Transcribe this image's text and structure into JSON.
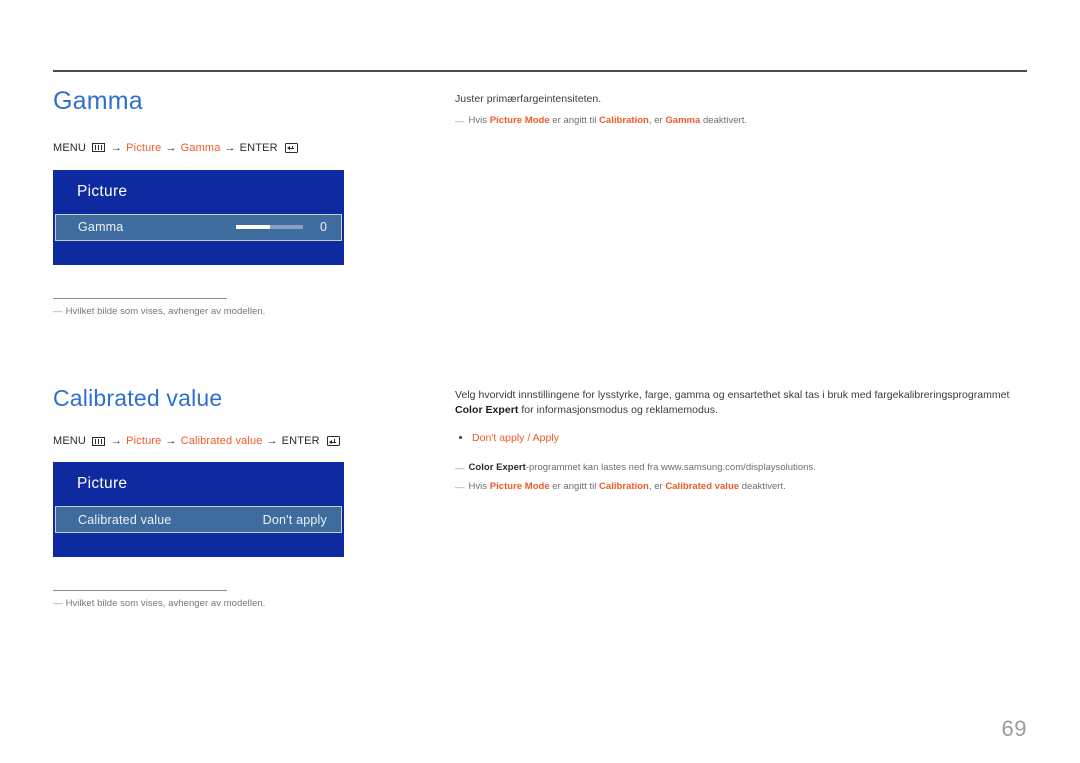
{
  "page": {
    "number": "69"
  },
  "sections": [
    {
      "title": "Gamma",
      "breadcrumb": {
        "menu_label": "MENU",
        "menu_icon": "menu-bars-icon",
        "arrow": "→",
        "parts": [
          "Picture",
          "Gamma"
        ],
        "enter_label": "ENTER",
        "enter_icon": "enter-return-icon"
      },
      "osd": {
        "header": "Picture",
        "row_label": "Gamma",
        "row_value": "0",
        "slider_fill_percent": 50
      },
      "footnote": {
        "dash": "―",
        "text": "Hvilket bilde som vises, avhenger av modellen."
      },
      "description": "Juster primærfargeintensiteten.",
      "notes": [
        {
          "dash": "―",
          "segments": [
            {
              "text": "Hvis ",
              "style": "plain"
            },
            {
              "text": "Picture Mode",
              "style": "accent"
            },
            {
              "text": " er angitt til ",
              "style": "plain"
            },
            {
              "text": "Calibration",
              "style": "accent"
            },
            {
              "text": ", er ",
              "style": "plain"
            },
            {
              "text": "Gamma",
              "style": "accent"
            },
            {
              "text": " deaktivert.",
              "style": "plain"
            }
          ]
        }
      ]
    },
    {
      "title": "Calibrated value",
      "breadcrumb": {
        "menu_label": "MENU",
        "menu_icon": "menu-bars-icon",
        "arrow": "→",
        "parts": [
          "Picture",
          "Calibrated value"
        ],
        "enter_label": "ENTER",
        "enter_icon": "enter-return-icon"
      },
      "osd": {
        "header": "Picture",
        "row_label": "Calibrated value",
        "row_value": "Don't apply"
      },
      "footnote": {
        "dash": "―",
        "text": "Hvilket bilde som vises, avhenger av modellen."
      },
      "description_segments": [
        {
          "text": "Velg hvorvidt innstillingene for lysstyrke, farge, gamma og ensartethet skal tas i bruk med fargekalibreringsprogrammet ",
          "style": "plain"
        },
        {
          "text": "Color Expert",
          "style": "bold"
        },
        {
          "text": " for informasjonsmodus og reklamemodus.",
          "style": "plain"
        }
      ],
      "options_bullet": "Don't apply / Apply",
      "notes": [
        {
          "dash": "―",
          "segments": [
            {
              "text": "Color Expert",
              "style": "bold-dark"
            },
            {
              "text": "-programmet kan lastes ned fra www.samsung.com/displaysolutions.",
              "style": "plain"
            }
          ]
        },
        {
          "dash": "―",
          "segments": [
            {
              "text": "Hvis ",
              "style": "plain"
            },
            {
              "text": "Picture Mode",
              "style": "accent"
            },
            {
              "text": " er angitt til ",
              "style": "plain"
            },
            {
              "text": "Calibration",
              "style": "accent"
            },
            {
              "text": ", er ",
              "style": "plain"
            },
            {
              "text": "Calibrated value",
              "style": "accent"
            },
            {
              "text": " deaktivert.",
              "style": "plain"
            }
          ]
        }
      ]
    }
  ],
  "colors": {
    "heading_blue": "#2f6fd0",
    "accent_orange": "#f05a28",
    "osd_blue": "#0e2aa0",
    "osd_row_blue": "#3f6c9e"
  }
}
